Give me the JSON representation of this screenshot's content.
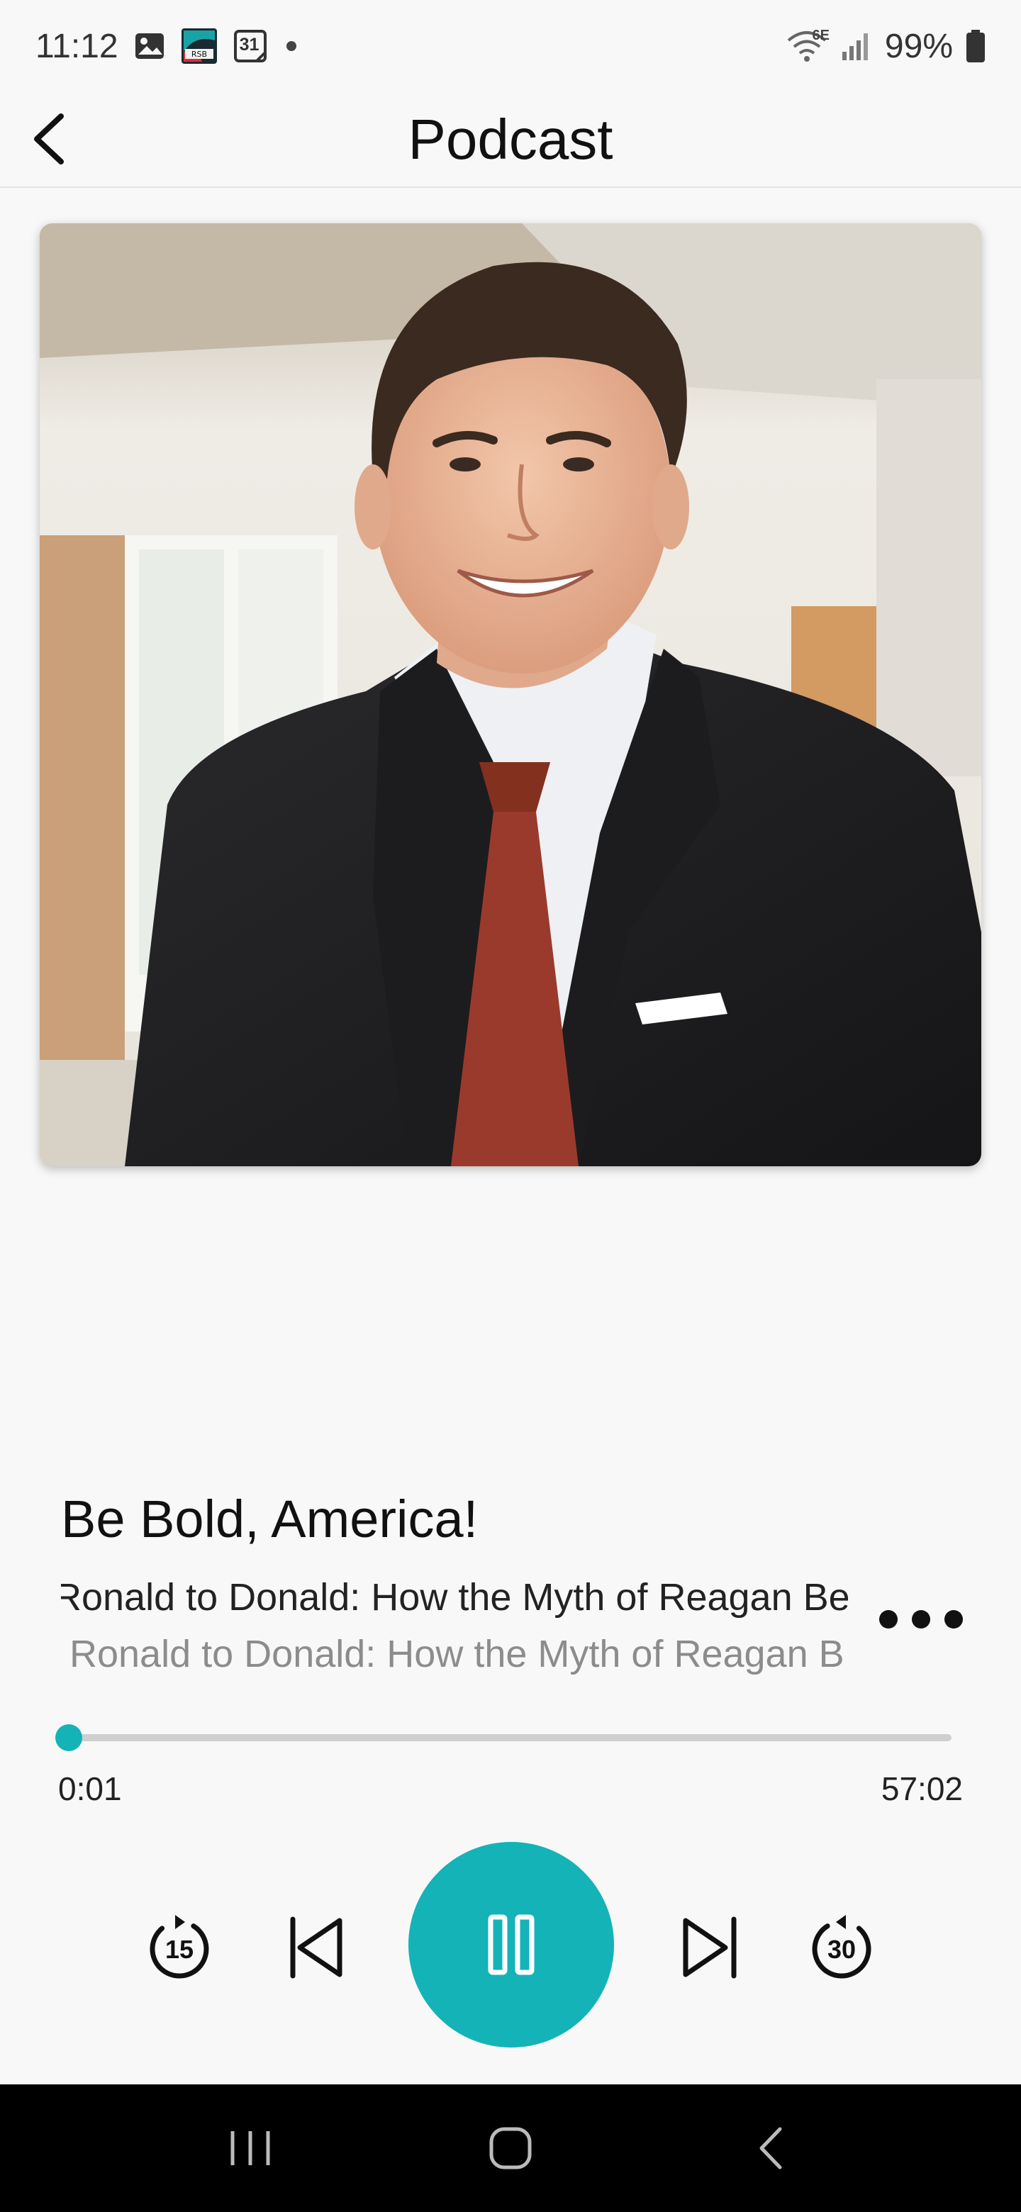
{
  "status_bar": {
    "time": "11:12",
    "calendar_day": "31",
    "battery": "99%",
    "network": "6E"
  },
  "header": {
    "title": "Podcast"
  },
  "episode": {
    "show_title": "Be Bold, America!",
    "title_line_1": "Ronald to Donald:  How the Myth of Reagan Be",
    "title_line_2": "Ronald to Donald:  How the Myth of Reagan B"
  },
  "player": {
    "elapsed": "0:01",
    "duration": "57:02",
    "progress_fraction": 0.0003,
    "skip_back_seconds": "15",
    "skip_forward_seconds": "30",
    "accent_color": "#14b3b8"
  },
  "icons": {
    "back": "chevron-left-icon",
    "more": "more-horizontal-icon",
    "skip_back": "replay-15-icon",
    "previous": "skip-previous-icon",
    "pause": "pause-icon",
    "next": "skip-next-icon",
    "skip_forward": "forward-30-icon"
  }
}
